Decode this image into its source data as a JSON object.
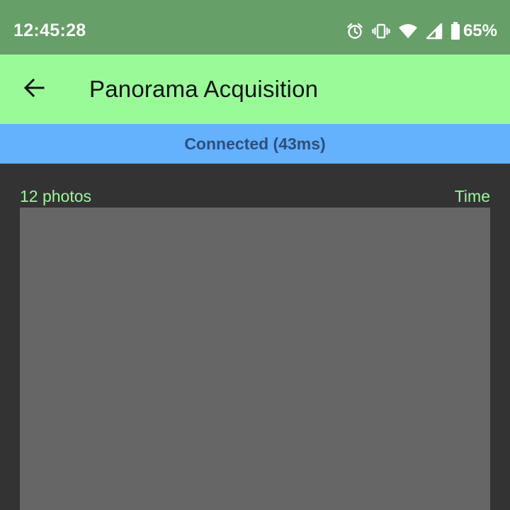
{
  "status_bar": {
    "time": "12:45:28",
    "icons": [
      "alarm-icon",
      "vibrate-icon",
      "wifi-icon",
      "signal-icon",
      "battery-icon"
    ],
    "battery_percent": "65%"
  },
  "app_bar": {
    "back_icon": "arrow-left-icon",
    "title": "Panorama Acquisition"
  },
  "connection": {
    "text": "Connected (43ms)"
  },
  "gallery": {
    "count_label": "12 photos",
    "sort_label": "Time"
  },
  "colors": {
    "status_bar_bg": "#669f68",
    "app_bar_bg": "#98fb98",
    "banner_bg": "#64b1fe",
    "content_bg": "#333333",
    "photo_area_bg": "#666666",
    "accent_text": "#98fb98"
  }
}
